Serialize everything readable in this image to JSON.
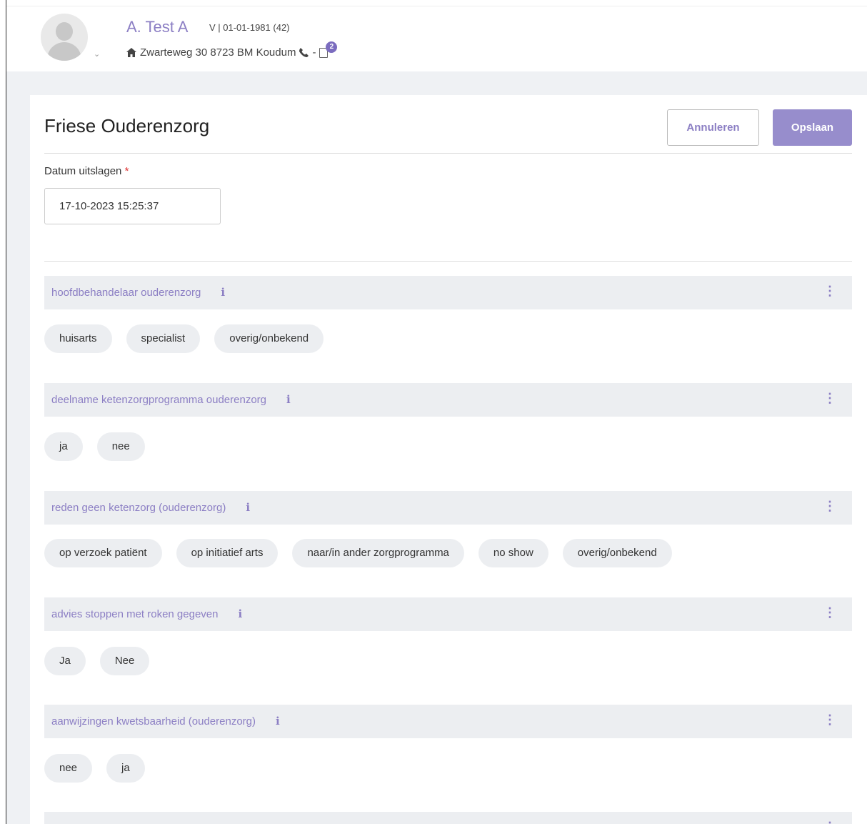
{
  "patient": {
    "name": "A. Test A",
    "meta": "V | 01-01-1981 (42)",
    "address": "Zwarteweg 30 8723 BM Koudum",
    "phone_separator": "-",
    "notification_count": "2"
  },
  "icons": [
    "avatar-icon",
    "chevron-down-icon",
    "home-icon",
    "phone-icon",
    "document-icon",
    "info-icon",
    "kebab-menu-icon"
  ],
  "card": {
    "title": "Friese Ouderenzorg",
    "cancel_label": "Annuleren",
    "save_label": "Opslaan",
    "date_label": "Datum uitslagen",
    "required_marker": "*",
    "date_value": "17-10-2023 15:25:37"
  },
  "sections": [
    {
      "title": "hoofdbehandelaar ouderenzorg",
      "options": [
        "huisarts",
        "specialist",
        "overig/onbekend"
      ]
    },
    {
      "title": "deelname ketenzorgprogramma ouderenzorg",
      "options": [
        "ja",
        "nee"
      ]
    },
    {
      "title": "reden geen ketenzorg (ouderenzorg)",
      "options": [
        "op verzoek patiënt",
        "op initiatief arts",
        "naar/in ander zorgprogramma",
        "no show",
        "overig/onbekend"
      ]
    },
    {
      "title": "advies stoppen met roken gegeven",
      "options": [
        "Ja",
        "Nee"
      ]
    },
    {
      "title": "aanwijzingen kwetsbaarheid (ouderenzorg)",
      "options": [
        "nee",
        "ja"
      ]
    },
    {
      "title": "",
      "options": []
    }
  ],
  "colors": {
    "accent": "#8c7fc4",
    "save_button": "#978dcc",
    "band": "#eff1f4",
    "chip": "#eceef1"
  }
}
